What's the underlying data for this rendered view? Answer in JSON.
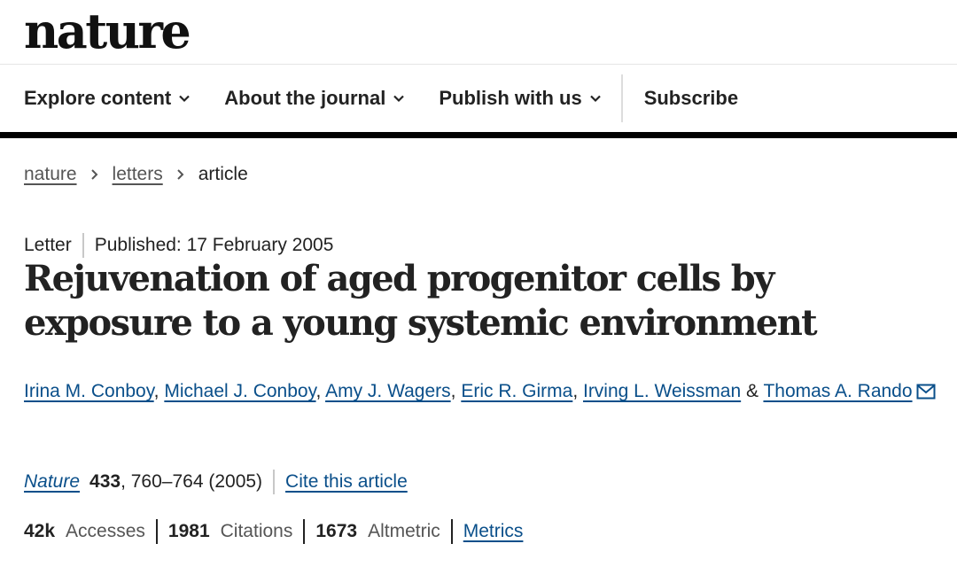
{
  "site": {
    "logo": "nature"
  },
  "nav": {
    "explore": "Explore content",
    "about": "About the journal",
    "publish": "Publish with us",
    "subscribe": "Subscribe"
  },
  "breadcrumb": {
    "home": "nature",
    "section": "letters",
    "current": "article"
  },
  "article": {
    "type": "Letter",
    "published": "Published: 17 February 2005",
    "title": "Rejuvenation of aged progenitor cells by exposure to a young systemic environment",
    "authors": [
      "Irina M. Conboy",
      "Michael J. Conboy",
      "Amy J. Wagers",
      "Eric R. Girma",
      "Irving L. Weissman",
      "Thomas A. Rando"
    ],
    "separator": ", ",
    "and": " & "
  },
  "citation": {
    "journal": "Nature",
    "volume": "433",
    "pages": ", 760–764 (2005)",
    "cite_link": "Cite this article"
  },
  "metrics": {
    "accesses_value": "42k",
    "accesses_label": "Accesses",
    "citations_value": "1981",
    "citations_label": "Citations",
    "altmetric_value": "1673",
    "altmetric_label": "Altmetric",
    "metrics_link": "Metrics"
  },
  "colors": {
    "link": "#0a4f8a",
    "text": "#222222",
    "rule": "#000000"
  }
}
